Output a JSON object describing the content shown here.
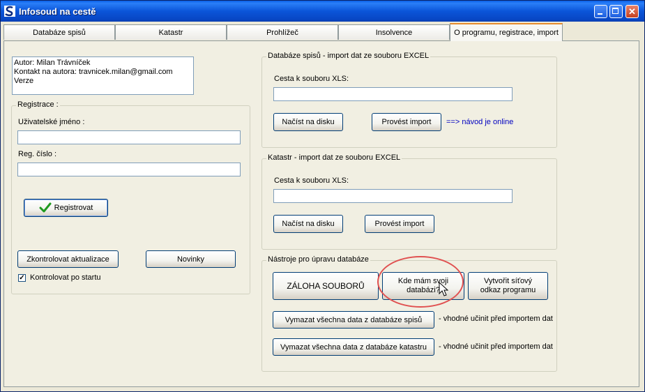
{
  "window": {
    "title": "Infosoud na cestě"
  },
  "tabs": [
    "Databáze spisů",
    "Katastr",
    "Prohlížeč",
    "Insolvence",
    "O programu, registrace, import"
  ],
  "about": {
    "lines": [
      "Autor: Milan Trávníček",
      "Kontakt na autora: travnicek.milan@gmail.com",
      "Verze"
    ]
  },
  "registration": {
    "group_title": "Registrace :",
    "username_label": "Uživatelské jméno :",
    "username_value": "",
    "regnum_label": "Reg. číslo :",
    "regnum_value": "",
    "register_button": "Registrovat",
    "check_updates_button": "Zkontrolovat aktualizace",
    "news_button": "Novinky",
    "check_on_start_label": "Kontrolovat po startu",
    "check_on_start_checked": true
  },
  "import_spisy": {
    "group_title": "Databáze spisů - import dat ze souboru EXCEL",
    "path_label": "Cesta k souboru XLS:",
    "path_value": "",
    "load_button": "Načíst na disku",
    "import_button": "Provést import",
    "online_link": "==> návod je online"
  },
  "import_katastr": {
    "group_title": "Katastr - import dat ze souboru EXCEL",
    "path_label": "Cesta k souboru XLS:",
    "path_value": "",
    "load_button": "Načíst na disku",
    "import_button": "Provést import"
  },
  "tools": {
    "group_title": "Nástroje pro úpravu databáze",
    "backup_button": "ZÁLOHA SOUBORŮ",
    "where_db_button": "Kde mám svoji databázi?",
    "shortcut_button": "Vytvořit síťový odkaz programu",
    "clear_spisy_button": "Vymazat všechna data z databáze spisů",
    "clear_spisy_hint": "- vhodné učinit před importem dat",
    "clear_katastr_button": "Vymazat všechna data z databáze katastru",
    "clear_katastr_hint": "- vhodné učinit před importem dat"
  },
  "colors": {
    "titlebar": "#0b55d9",
    "face": "#ece9d8",
    "link": "#0000c0",
    "highlight": "#e05050",
    "check_green": "#1f9a1f"
  }
}
